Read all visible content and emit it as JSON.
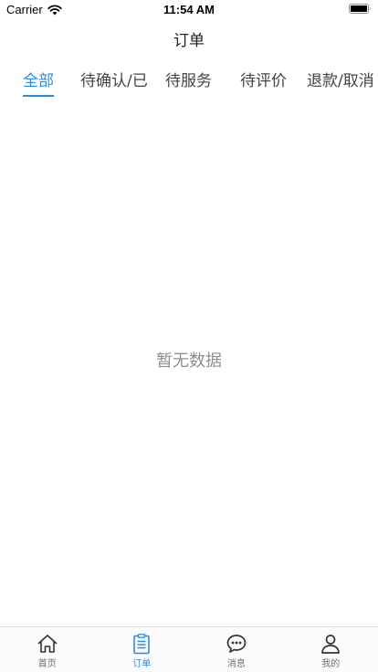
{
  "status_bar": {
    "carrier": "Carrier",
    "time": "11:54 AM"
  },
  "header": {
    "title": "订单"
  },
  "order_tabs": [
    {
      "label": "全部",
      "active": true
    },
    {
      "label": "待确认/已",
      "active": false
    },
    {
      "label": "待服务",
      "active": false
    },
    {
      "label": "待评价",
      "active": false
    },
    {
      "label": "退款/取消",
      "active": false
    }
  ],
  "empty_state": {
    "text": "暂无数据"
  },
  "tab_bar": {
    "items": [
      {
        "label": "首页",
        "icon": "home-icon",
        "active": false
      },
      {
        "label": "订单",
        "icon": "clipboard-icon",
        "active": true
      },
      {
        "label": "消息",
        "icon": "chat-bubble-icon",
        "active": false
      },
      {
        "label": "我的",
        "icon": "person-icon",
        "active": false
      }
    ]
  },
  "colors": {
    "accent": "#2a8be0",
    "inactive_icon": "#333333",
    "empty_text": "#8f8f8f"
  }
}
